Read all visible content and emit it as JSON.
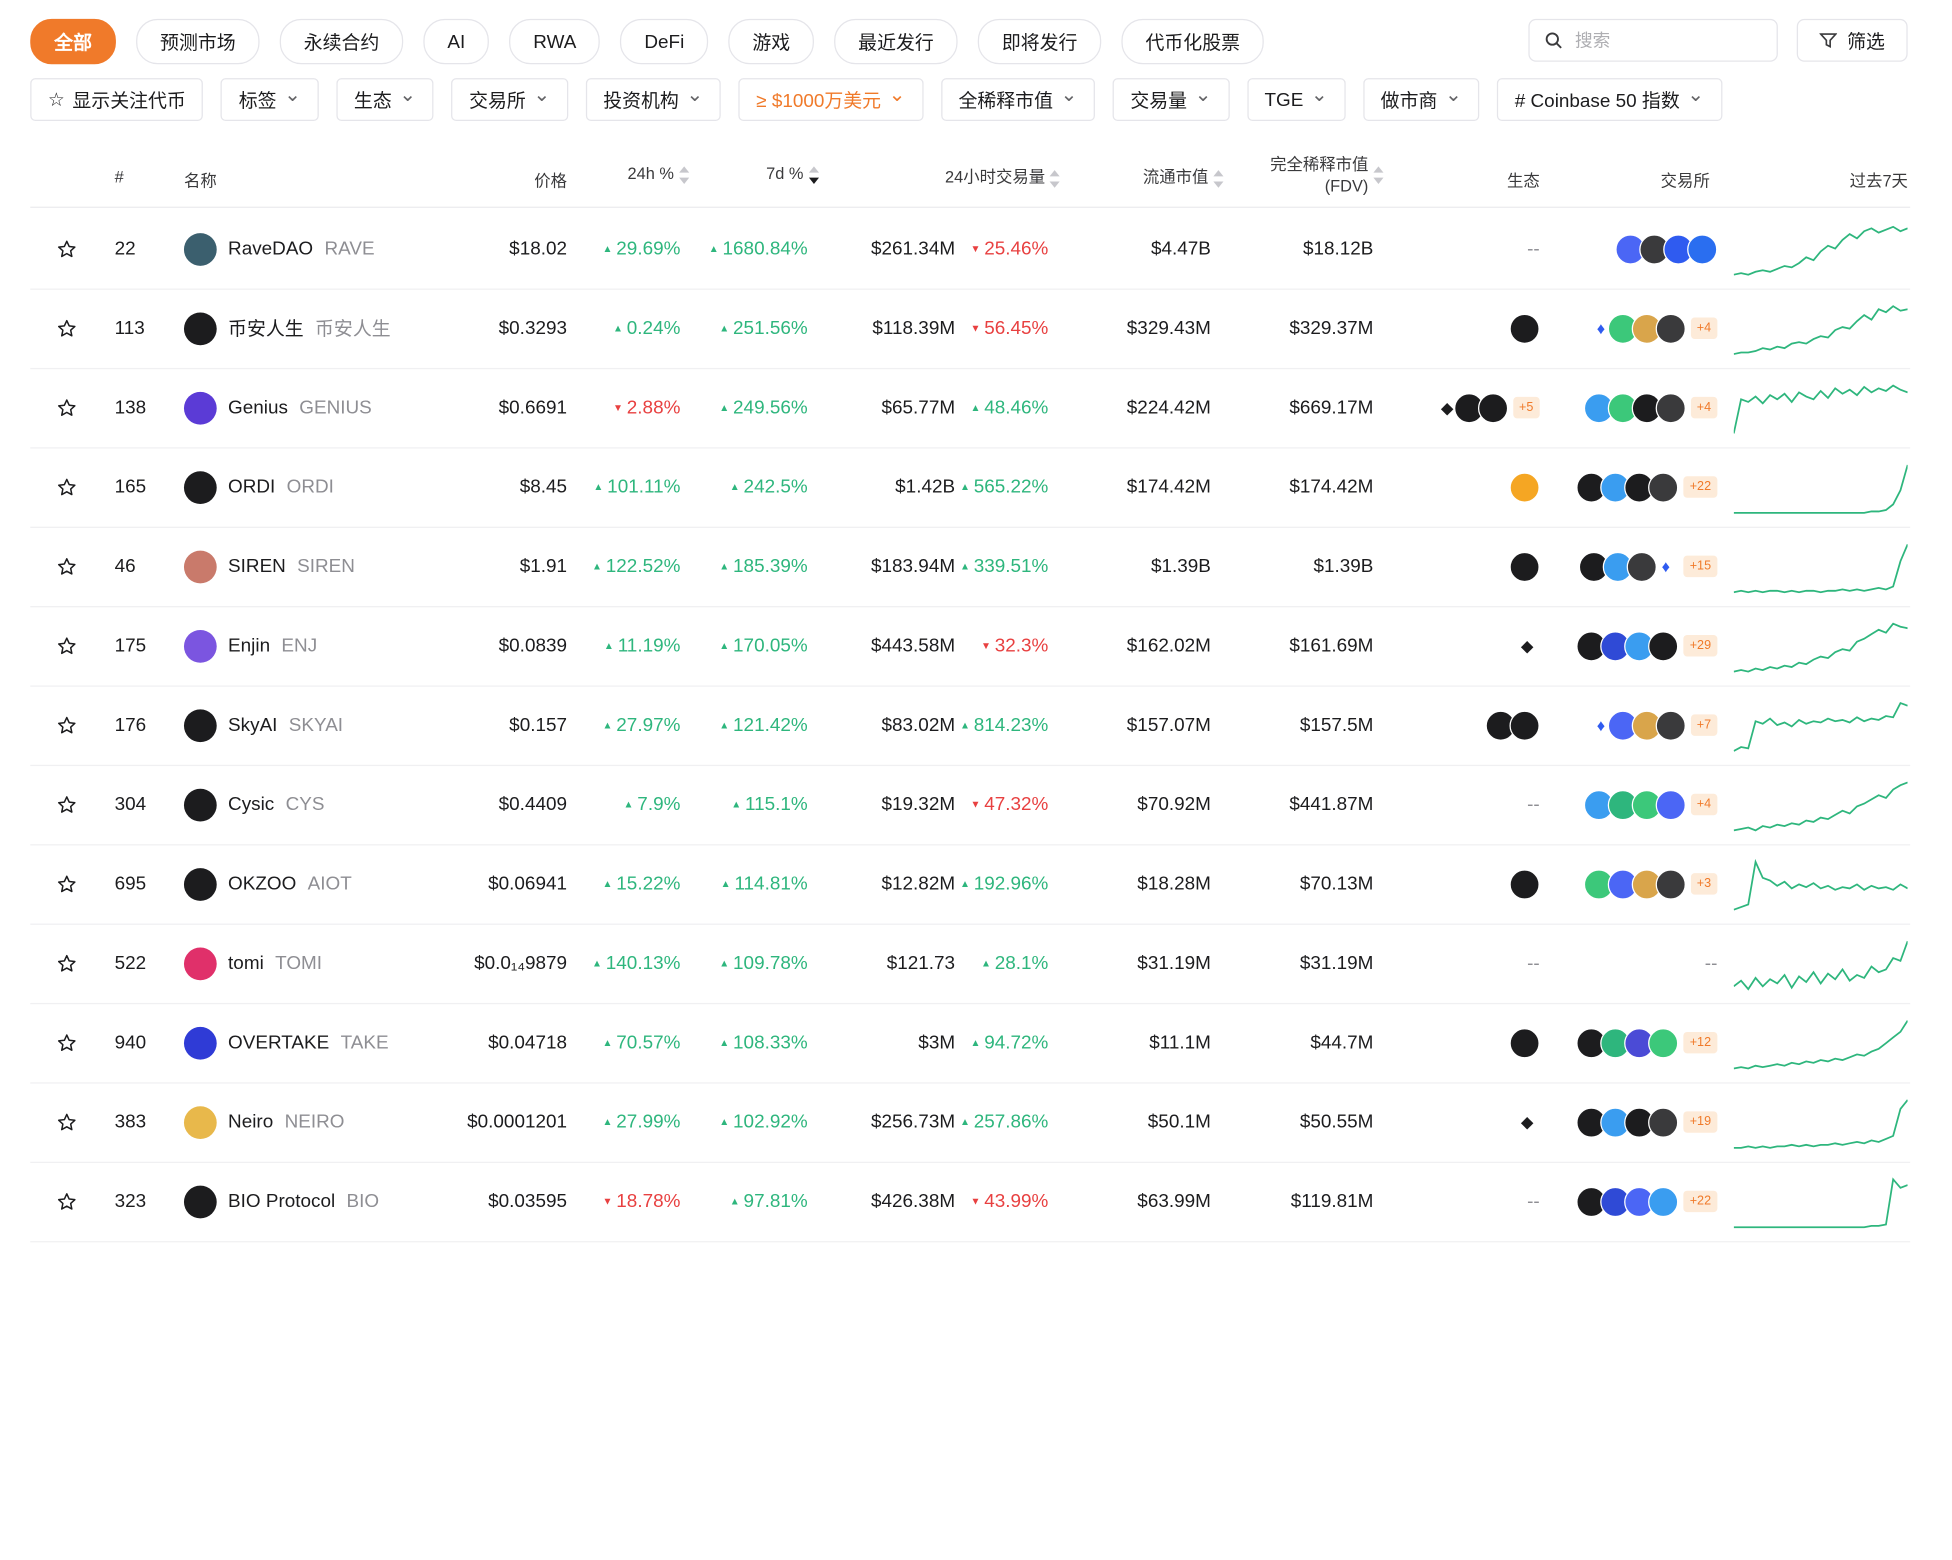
{
  "categories": [
    "全部",
    "预测市场",
    "永续合约",
    "AI",
    "RWA",
    "DeFi",
    "游戏",
    "最近发行",
    "即将发行",
    "代币化股票"
  ],
  "search": {
    "placeholder": "搜索"
  },
  "filter_button": "筛选",
  "filters": [
    {
      "label": "显示关注代币",
      "chevron": false,
      "orange": false
    },
    {
      "label": "标签",
      "chevron": true,
      "orange": false
    },
    {
      "label": "生态",
      "chevron": true,
      "orange": false
    },
    {
      "label": "交易所",
      "chevron": true,
      "orange": false
    },
    {
      "label": "投资机构",
      "chevron": true,
      "orange": false
    },
    {
      "label": "≥ $1000万美元",
      "chevron": true,
      "orange": true
    },
    {
      "label": "全稀释市值",
      "chevron": true,
      "orange": false
    },
    {
      "label": "交易量",
      "chevron": true,
      "orange": false
    },
    {
      "label": "TGE",
      "chevron": true,
      "orange": false
    },
    {
      "label": "做市商",
      "chevron": true,
      "orange": false
    },
    {
      "label": "# Coinbase 50 指数",
      "chevron": true,
      "orange": false
    }
  ],
  "headers": {
    "rank": "#",
    "name": "名称",
    "price": "价格",
    "change24h": "24h %",
    "change7d": "7d %",
    "volume": "24小时交易量",
    "mcap": "流通市值",
    "fdv_line1": "完全稀释市值",
    "fdv_line2": "(FDV)",
    "eco": "生态",
    "exchange": "交易所",
    "spark": "过去7天"
  },
  "colors": {
    "accent": "#f07a2a",
    "up": "#2eb67d",
    "down": "#e84040"
  },
  "rows": [
    {
      "rank": "22",
      "name": "RaveDAO",
      "symbol": "RAVE",
      "price": "$18.02",
      "c24": "29.69%",
      "c24dir": "up",
      "c7": "1680.84%",
      "c7dir": "up",
      "vol": "$261.34M",
      "vch": "25.46%",
      "vchdir": "down",
      "mcap": "$4.47B",
      "fdv": "$18.12B",
      "eco": [],
      "eco_more": "",
      "exch": [
        "#4b66f5",
        "#3a3a3c",
        "#2f5bf0",
        "#2a6ef0"
      ],
      "exch_more": "",
      "logo": "#3b5f6e",
      "spark": [
        10,
        11,
        10,
        12,
        13,
        12,
        14,
        16,
        15,
        18,
        22,
        20,
        26,
        30,
        28,
        34,
        38,
        35,
        40,
        42,
        39,
        41,
        43,
        40,
        42
      ]
    },
    {
      "rank": "113",
      "name": "币安人生",
      "symbol": "币安人生",
      "price": "$0.3293",
      "c24": "0.24%",
      "c24dir": "up",
      "c7": "251.56%",
      "c7dir": "up",
      "vol": "$118.39M",
      "vch": "56.45%",
      "vchdir": "down",
      "mcap": "$329.43M",
      "fdv": "$329.37M",
      "eco": [
        "#1c1c1e"
      ],
      "eco_more": "",
      "exch": [
        "flame",
        "#3cc87a",
        "#d9a54b",
        "#3a3a3c"
      ],
      "exch_more": "+4",
      "logo": "#1c1c1e",
      "spark": [
        8,
        9,
        9,
        10,
        12,
        11,
        13,
        12,
        15,
        16,
        15,
        18,
        20,
        19,
        24,
        26,
        25,
        30,
        34,
        31,
        38,
        36,
        40,
        37,
        38
      ]
    },
    {
      "rank": "138",
      "name": "Genius",
      "symbol": "GENIUS",
      "price": "$0.6691",
      "c24": "2.88%",
      "c24dir": "down",
      "c7": "249.56%",
      "c7dir": "up",
      "vol": "$65.77M",
      "vch": "48.46%",
      "vchdir": "up",
      "mcap": "$224.42M",
      "fdv": "$669.17M",
      "eco": [
        "eth",
        "#1c1c1e",
        "#1c1c1e"
      ],
      "eco_more": "+5",
      "exch": [
        "#3a9df0",
        "#3cc87a",
        "#1c1c1e",
        "#3a3a3c"
      ],
      "exch_more": "+4",
      "logo": "#5b3bd6",
      "spark": [
        5,
        30,
        28,
        32,
        27,
        33,
        30,
        34,
        28,
        35,
        32,
        30,
        36,
        31,
        38,
        34,
        37,
        33,
        39,
        35,
        38,
        36,
        40,
        37,
        35
      ]
    },
    {
      "rank": "165",
      "name": "ORDI",
      "symbol": "ORDI",
      "price": "$8.45",
      "c24": "101.11%",
      "c24dir": "up",
      "c7": "242.5%",
      "c7dir": "up",
      "vol": "$1.42B",
      "vch": "565.22%",
      "vchdir": "up",
      "mcap": "$174.42M",
      "fdv": "$174.42M",
      "eco": [
        "#f5a623"
      ],
      "eco_more": "",
      "exch": [
        "#1c1c1e",
        "#3a9df0",
        "#1c1c1e",
        "#3a3a3c"
      ],
      "exch_more": "+22",
      "logo": "#1c1c1e",
      "spark": [
        8,
        8,
        8,
        8,
        8,
        8,
        8,
        8,
        8,
        8,
        8,
        8,
        8,
        8,
        8,
        8,
        8,
        8,
        8,
        9,
        9,
        10,
        14,
        24,
        42
      ]
    },
    {
      "rank": "46",
      "name": "SIREN",
      "symbol": "SIREN",
      "price": "$1.91",
      "c24": "122.52%",
      "c24dir": "up",
      "c7": "185.39%",
      "c7dir": "up",
      "vol": "$183.94M",
      "vch": "339.51%",
      "vchdir": "up",
      "mcap": "$1.39B",
      "fdv": "$1.39B",
      "eco": [
        "#1c1c1e"
      ],
      "eco_more": "",
      "exch": [
        "#1c1c1e",
        "#3a9df0",
        "#3a3a3c",
        "flame"
      ],
      "exch_more": "+15",
      "logo": "#c97a6b",
      "spark": [
        8,
        9,
        8,
        9,
        8,
        9,
        9,
        8,
        9,
        8,
        9,
        9,
        8,
        9,
        9,
        10,
        9,
        10,
        9,
        10,
        11,
        10,
        12,
        30,
        42
      ]
    },
    {
      "rank": "175",
      "name": "Enjin",
      "symbol": "ENJ",
      "price": "$0.0839",
      "c24": "11.19%",
      "c24dir": "up",
      "c7": "170.05%",
      "c7dir": "up",
      "vol": "$443.58M",
      "vch": "32.3%",
      "vchdir": "down",
      "mcap": "$162.02M",
      "fdv": "$161.69M",
      "eco": [
        "eth"
      ],
      "eco_more": "",
      "exch": [
        "#1c1c1e",
        "#2f4ad6",
        "#3a9df0",
        "#1c1c1e"
      ],
      "exch_more": "+29",
      "logo": "#7b55e0",
      "spark": [
        8,
        9,
        8,
        10,
        9,
        11,
        10,
        12,
        11,
        14,
        13,
        16,
        18,
        17,
        21,
        23,
        22,
        28,
        30,
        33,
        36,
        34,
        40,
        38,
        37
      ]
    },
    {
      "rank": "176",
      "name": "SkyAI",
      "symbol": "SKYAI",
      "price": "$0.157",
      "c24": "27.97%",
      "c24dir": "up",
      "c7": "121.42%",
      "c7dir": "up",
      "vol": "$83.02M",
      "vch": "814.23%",
      "vchdir": "up",
      "mcap": "$157.07M",
      "fdv": "$157.5M",
      "eco": [
        "#1c1c1e",
        "#1c1c1e"
      ],
      "eco_more": "",
      "exch": [
        "flame",
        "#4b66f5",
        "#d9a54b",
        "#3a3a3c"
      ],
      "exch_more": "+7",
      "logo": "#1c1c1e",
      "spark": [
        5,
        8,
        7,
        28,
        26,
        30,
        25,
        27,
        24,
        29,
        26,
        28,
        27,
        30,
        28,
        29,
        27,
        31,
        28,
        30,
        29,
        32,
        31,
        42,
        40
      ]
    },
    {
      "rank": "304",
      "name": "Cysic",
      "symbol": "CYS",
      "price": "$0.4409",
      "c24": "7.9%",
      "c24dir": "up",
      "c7": "115.1%",
      "c7dir": "up",
      "vol": "$19.32M",
      "vch": "47.32%",
      "vchdir": "down",
      "mcap": "$70.92M",
      "fdv": "$441.87M",
      "eco": [],
      "eco_more": "",
      "exch": [
        "#3a9df0",
        "#2eb67d",
        "#3cc87a",
        "#4b66f5"
      ],
      "exch_more": "+4",
      "logo": "#1c1c1e",
      "spark": [
        8,
        9,
        10,
        8,
        11,
        10,
        12,
        11,
        13,
        12,
        15,
        14,
        17,
        16,
        19,
        22,
        20,
        25,
        27,
        30,
        33,
        31,
        37,
        40,
        42
      ]
    },
    {
      "rank": "695",
      "name": "OKZOO",
      "symbol": "AIOT",
      "price": "$0.06941",
      "c24": "15.22%",
      "c24dir": "up",
      "c7": "114.81%",
      "c7dir": "up",
      "vol": "$12.82M",
      "vch": "192.96%",
      "vchdir": "up",
      "mcap": "$18.28M",
      "fdv": "$70.13M",
      "eco": [
        "#1c1c1e"
      ],
      "eco_more": "",
      "exch": [
        "#3cc87a",
        "#4b66f5",
        "#d9a54b",
        "#3a3a3c"
      ],
      "exch_more": "+3",
      "logo": "#1c1c1e",
      "spark": [
        6,
        8,
        10,
        42,
        30,
        28,
        24,
        27,
        22,
        25,
        23,
        26,
        22,
        24,
        21,
        23,
        22,
        25,
        21,
        24,
        22,
        23,
        21,
        25,
        22
      ]
    },
    {
      "rank": "522",
      "name": "tomi",
      "symbol": "TOMI",
      "price": "$0.0₁₄9879",
      "c24": "140.13%",
      "c24dir": "up",
      "c7": "109.78%",
      "c7dir": "up",
      "vol": "$121.73",
      "vch": "28.1%",
      "vchdir": "up",
      "mcap": "$31.19M",
      "fdv": "$31.19M",
      "eco": [],
      "eco_more": "",
      "exch": [],
      "exch_more": "",
      "logo": "#e0306a",
      "spark": [
        10,
        14,
        8,
        16,
        10,
        15,
        12,
        18,
        9,
        17,
        13,
        20,
        12,
        19,
        15,
        22,
        14,
        18,
        16,
        24,
        20,
        22,
        30,
        28,
        42
      ]
    },
    {
      "rank": "940",
      "name": "OVERTAKE",
      "symbol": "TAKE",
      "price": "$0.04718",
      "c24": "70.57%",
      "c24dir": "up",
      "c7": "108.33%",
      "c7dir": "up",
      "vol": "$3M",
      "vch": "94.72%",
      "vchdir": "up",
      "mcap": "$11.1M",
      "fdv": "$44.7M",
      "eco": [
        "#1c1c1e"
      ],
      "eco_more": "",
      "exch": [
        "#1c1c1e",
        "#2eb67d",
        "#4b4bd6",
        "#3cc87a"
      ],
      "exch_more": "+12",
      "logo": "#2f3bd6",
      "spark": [
        8,
        9,
        8,
        10,
        9,
        10,
        11,
        10,
        12,
        11,
        13,
        12,
        14,
        13,
        15,
        14,
        16,
        18,
        17,
        20,
        22,
        26,
        30,
        34,
        42
      ]
    },
    {
      "rank": "383",
      "name": "Neiro",
      "symbol": "NEIRO",
      "price": "$0.0001201",
      "c24": "27.99%",
      "c24dir": "up",
      "c7": "102.92%",
      "c7dir": "up",
      "vol": "$256.73M",
      "vch": "257.86%",
      "vchdir": "up",
      "mcap": "$50.1M",
      "fdv": "$50.55M",
      "eco": [
        "eth"
      ],
      "eco_more": "",
      "exch": [
        "#1c1c1e",
        "#3a9df0",
        "#1c1c1e",
        "#3a3a3c"
      ],
      "exch_more": "+19",
      "logo": "#e8b84b",
      "spark": [
        8,
        8,
        9,
        8,
        9,
        8,
        9,
        9,
        10,
        9,
        10,
        9,
        10,
        10,
        11,
        10,
        11,
        12,
        11,
        13,
        12,
        14,
        16,
        34,
        40
      ]
    },
    {
      "rank": "323",
      "name": "BIO Protocol",
      "symbol": "BIO",
      "price": "$0.03595",
      "c24": "18.78%",
      "c24dir": "down",
      "c7": "97.81%",
      "c7dir": "up",
      "vol": "$426.38M",
      "vch": "43.99%",
      "vchdir": "down",
      "mcap": "$63.99M",
      "fdv": "$119.81M",
      "eco": [],
      "eco_more": "",
      "exch": [
        "#1c1c1e",
        "#2f4ad6",
        "#4b66f5",
        "#3a9df0"
      ],
      "exch_more": "+22",
      "logo": "#1c1c1e",
      "spark": [
        8,
        8,
        8,
        8,
        8,
        8,
        8,
        8,
        8,
        8,
        8,
        8,
        8,
        8,
        8,
        8,
        8,
        8,
        8,
        9,
        9,
        10,
        42,
        36,
        38
      ]
    }
  ]
}
